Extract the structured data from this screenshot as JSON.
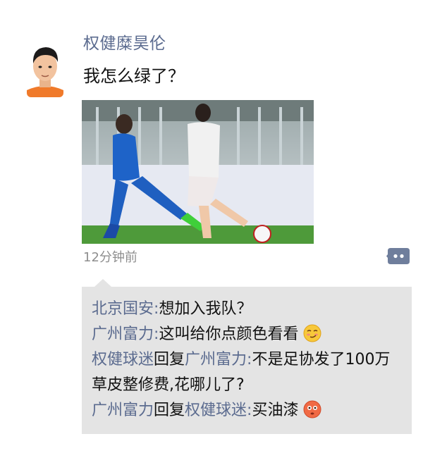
{
  "post": {
    "author": "权健糜昊伦",
    "text": "我怎么绿了？",
    "time": "12分钟前"
  },
  "comments": [
    {
      "user": "北京国安",
      "sep": ":",
      "text": "想加入我队？"
    },
    {
      "user": "广州富力",
      "sep": ":",
      "text": "这叫给你点颜色看看",
      "emoji": "smirk-face-emoji"
    },
    {
      "user": "权健球迷",
      "reply_word": "回复",
      "reply_to": "广州富力",
      "sep": ":",
      "text": "不是足协发了100万草皮整修费,花哪儿了?"
    },
    {
      "user": "广州富力",
      "reply_word": "回复",
      "reply_to": "权健球迷",
      "sep": ":",
      "text": "买油漆",
      "emoji": "flushed-face-emoji"
    }
  ],
  "colors": {
    "nickname": "#5b6b8f",
    "comment_bg": "#e4e4e4",
    "time": "#8e8e8e",
    "action_button": "#6f7e9c"
  },
  "icons": {
    "comment_action": "comment-dots-icon"
  }
}
